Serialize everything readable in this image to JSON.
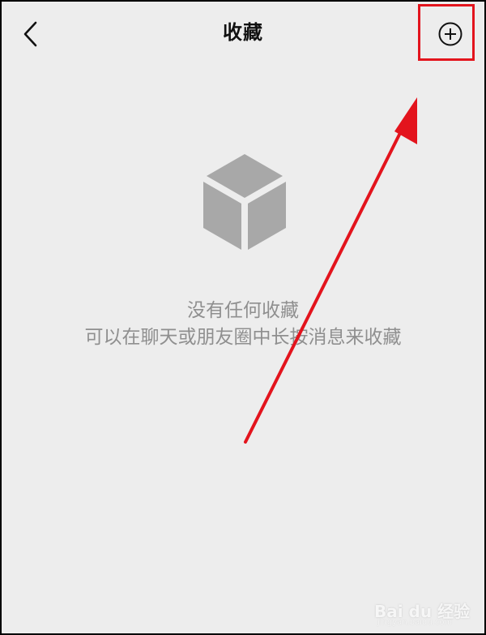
{
  "header": {
    "title": "收藏",
    "back_icon": "chevron-left-icon",
    "add_icon": "plus-circle-icon"
  },
  "empty_state": {
    "icon": "cube-icon",
    "title": "没有任何收藏",
    "subtitle": "可以在聊天或朋友圈中长按消息来收藏"
  },
  "annotation": {
    "highlight_color": "#e3141d",
    "arrow_color": "#e3141d"
  },
  "watermark": {
    "logo": "Bai du 经验",
    "site": "jingyan.baidu.com"
  },
  "colors": {
    "background": "#ededed",
    "text_primary": "#111111",
    "text_secondary": "#8f8f8f",
    "icon_gray": "#a8a8a8"
  }
}
